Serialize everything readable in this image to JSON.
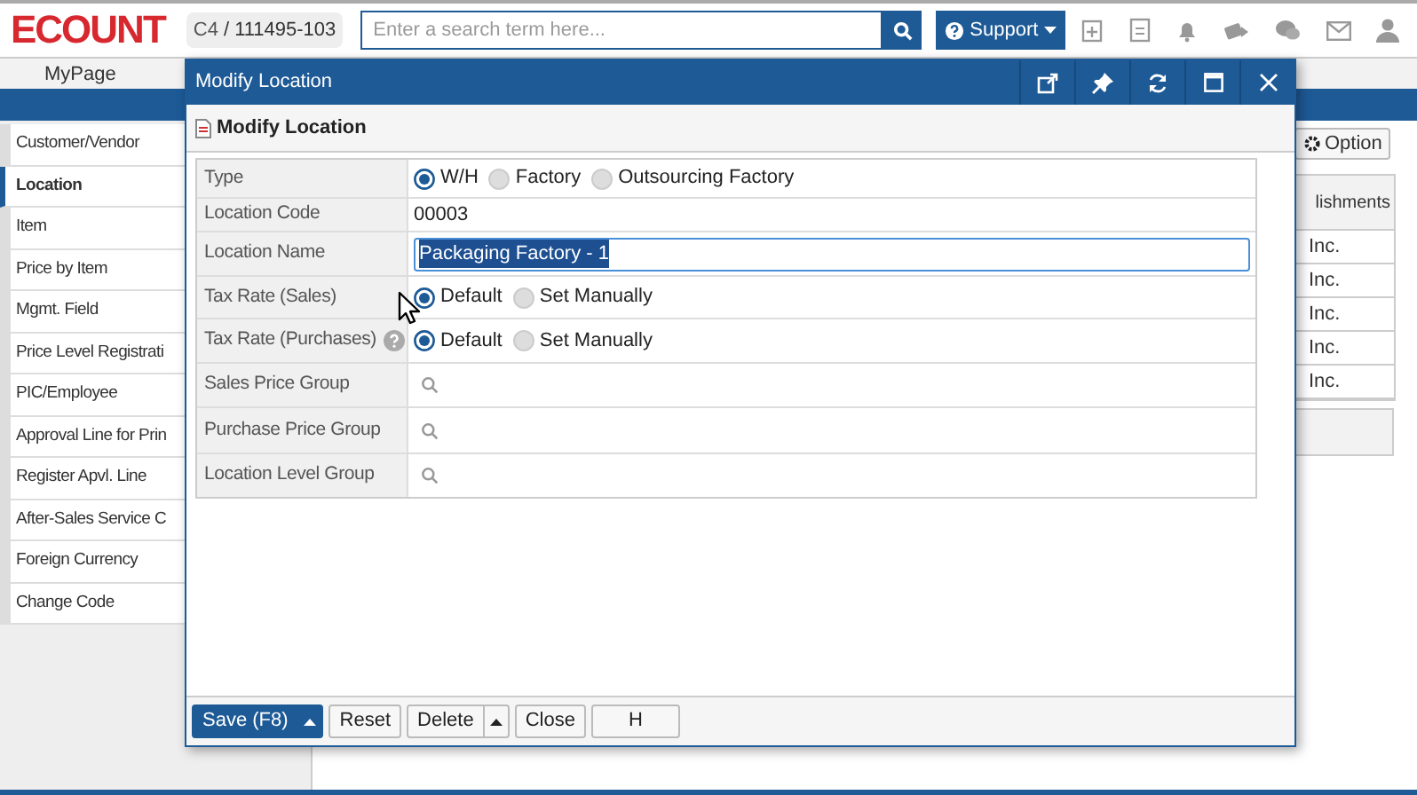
{
  "header": {
    "logo": "ECOUNT",
    "company_code": "C4",
    "account": "/ 111495-103",
    "search": {
      "placeholder": "Enter a search term here..."
    },
    "support_button": "Support"
  },
  "nav": {
    "tabs": [
      {
        "label": "MyPage",
        "selected": false
      }
    ]
  },
  "sidebar": {
    "items": [
      {
        "label": "Customer/Vendor",
        "selected": false
      },
      {
        "label": "Location",
        "selected": true
      },
      {
        "label": "Item",
        "selected": false
      },
      {
        "label": "Price by Item",
        "selected": false
      },
      {
        "label": "Mgmt. Field",
        "selected": false
      },
      {
        "label": "Price Level Registrati",
        "selected": false
      },
      {
        "label": "PIC/Employee",
        "selected": false
      },
      {
        "label": "Approval Line for Prin",
        "selected": false
      },
      {
        "label": "Register Apvl. Line",
        "selected": false
      },
      {
        "label": "After-Sales Service C",
        "selected": false
      },
      {
        "label": "Foreign Currency",
        "selected": false
      },
      {
        "label": "Change Code",
        "selected": false
      }
    ]
  },
  "background": {
    "option_button": "Option",
    "table": {
      "column_1": "lishments",
      "rows": [
        "Inc.",
        "Inc.",
        "Inc.",
        "Inc.",
        "Inc."
      ]
    }
  },
  "dialog": {
    "title": "Modify Location",
    "subtitle": "Modify Location",
    "fields": [
      {
        "kind": "radio",
        "label": "Type",
        "options": [
          {
            "label": "W/H",
            "selected": true
          },
          {
            "label": "Factory",
            "selected": false
          },
          {
            "label": "Outsourcing Factory",
            "selected": false
          }
        ]
      },
      {
        "kind": "text",
        "label": "Location Code",
        "value": "00003"
      },
      {
        "kind": "input",
        "label": "Location Name",
        "value": "Packaging Factory - 1"
      },
      {
        "kind": "radio",
        "label": "Tax Rate (Sales)",
        "options": [
          {
            "label": "Default",
            "selected": true
          },
          {
            "label": "Set Manually",
            "selected": false
          }
        ]
      },
      {
        "kind": "radio",
        "label": "Tax Rate (Purchases)",
        "help": true,
        "options": [
          {
            "label": "Default",
            "selected": true
          },
          {
            "label": "Set Manually",
            "selected": false
          }
        ]
      },
      {
        "kind": "search",
        "label": "Sales Price Group"
      },
      {
        "kind": "search",
        "label": "Purchase Price Group"
      },
      {
        "kind": "search",
        "label": "Location Level Group"
      }
    ],
    "buttons": [
      {
        "kind": "primary-split",
        "label": "Save (F8)"
      },
      {
        "kind": "plain",
        "label": "Reset"
      },
      {
        "kind": "split",
        "label": "Delete"
      },
      {
        "kind": "plain",
        "label": "Close"
      },
      {
        "kind": "wide",
        "label": "H"
      }
    ]
  }
}
